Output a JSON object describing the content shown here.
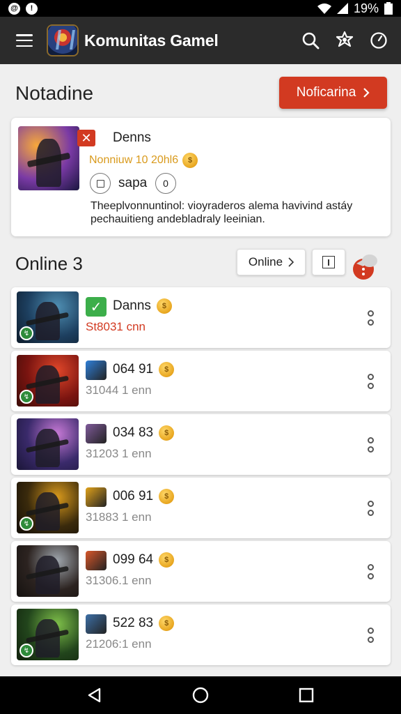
{
  "status_bar": {
    "battery": "19%"
  },
  "app_bar": {
    "title": "Komunitas Gamel"
  },
  "header": {
    "title": "Notadine",
    "notif_button": "Noficarina"
  },
  "featured": {
    "name": "Denns",
    "subtitle": "Nonniuw 10 20hl6",
    "chip_label": "sapa",
    "chip_count": "0",
    "description": "Theeplvonnuntinol: vioyraderos alema havivind astáy pechauitieng andebladraly leeinian."
  },
  "online": {
    "title": "Online 3",
    "filter_label": "Online"
  },
  "rows": [
    {
      "name": "Danns",
      "sub": "St8031 cnn",
      "sub_red": true,
      "icon": "check-icon",
      "icon_color": "#3cae4a",
      "art": [
        "#1d3f5f",
        "#4f8fb3",
        "#0d1b2a"
      ],
      "online": true
    },
    {
      "name": "064 91",
      "sub": "31044 1 enn",
      "sub_red": false,
      "icon": "blue-game-icon",
      "icon_color": "#2f7fd8",
      "art": [
        "#7a1410",
        "#e0472a",
        "#3a0c08"
      ],
      "online": true
    },
    {
      "name": "034 83",
      "sub": "31203 1 enn",
      "sub_red": false,
      "icon": "hero-game-icon",
      "icon_color": "#7f5a9a",
      "art": [
        "#3a2a6b",
        "#c77ad6",
        "#1b1638"
      ],
      "online": false
    },
    {
      "name": "006 91",
      "sub": "31883 1 enn",
      "sub_red": false,
      "icon": "gold-game-icon",
      "icon_color": "#e0a21b",
      "art": [
        "#3a2a0c",
        "#d99a1c",
        "#120d05"
      ],
      "online": true
    },
    {
      "name": "099 64",
      "sub": "31306.1 enn",
      "sub_red": false,
      "icon": "fire-game-icon",
      "icon_color": "#d8572a",
      "art": [
        "#2c2320",
        "#9fa6ad",
        "#151210"
      ],
      "online": false
    },
    {
      "name": "522 83",
      "sub": "21206:1 enn",
      "sub_red": false,
      "icon": "tactic-game-icon",
      "icon_color": "#3d6fa6",
      "art": [
        "#22451c",
        "#7fc04a",
        "#10200c"
      ],
      "online": true
    }
  ],
  "colors": {
    "accent": "#d23a21",
    "gold": "#d99a1c",
    "online_green": "#2e8b3a"
  }
}
